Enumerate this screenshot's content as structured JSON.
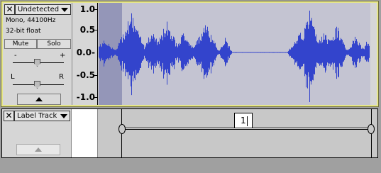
{
  "audio_track": {
    "close_glyph": "✕",
    "name": "Undetected",
    "format": "Mono, 44100Hz",
    "bit_depth": "32-bit float",
    "mute_label": "Mute",
    "solo_label": "Solo",
    "gain_minus": "-",
    "gain_plus": "+",
    "pan_left": "L",
    "pan_right": "R",
    "ruler_ticks": [
      "1.0",
      "0.5",
      "0.0-",
      "-0.5",
      "-1.0"
    ],
    "waveform_color": "#3344cc",
    "background_color": "#9496b8",
    "selection_color": "#c4c4d2"
  },
  "label_track": {
    "close_glyph": "✕",
    "name": "Label Track",
    "label_text": "1"
  }
}
